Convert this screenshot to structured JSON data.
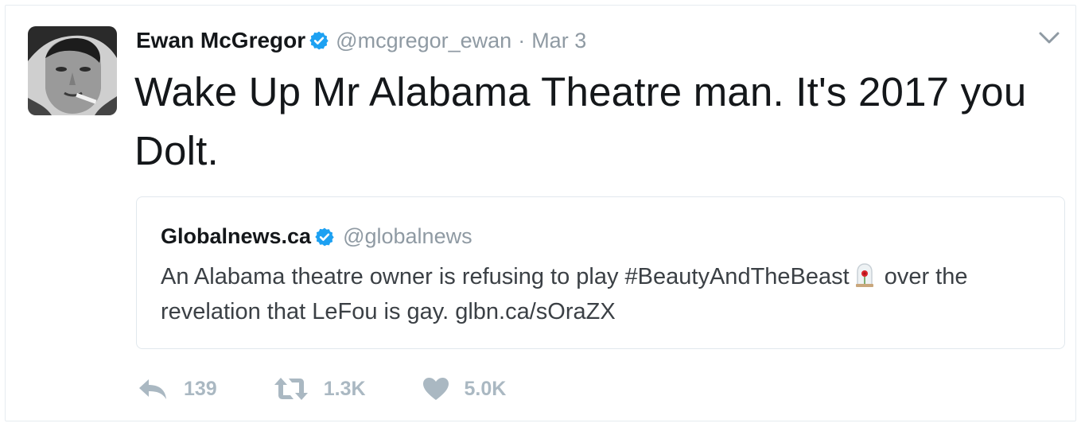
{
  "tweet": {
    "author": {
      "name": "Ewan McGregor",
      "handle": "@mcgregor_ewan",
      "verified_icon": "verified-badge-icon"
    },
    "separator": "·",
    "timestamp": "Mar 3",
    "text": "Wake Up Mr Alabama Theatre man. It's 2017 you Dolt.",
    "quoted": {
      "name": "Globalnews.ca",
      "handle": "@globalnews",
      "text_before_emoji": "An Alabama theatre owner is refusing to play #BeautyAndTheBeast",
      "emoji": "rose-in-bell-jar-icon",
      "text_after_emoji": "over the revelation that LeFou is gay. glbn.ca/sOraZX"
    },
    "actions": {
      "reply_count": "139",
      "retweet_count": "1.3K",
      "like_count": "5.0K"
    }
  },
  "colors": {
    "verified": "#1da1f2",
    "muted_text": "#8f9aa3",
    "action_gray": "#aab8c2",
    "border": "#e1e8ed"
  }
}
